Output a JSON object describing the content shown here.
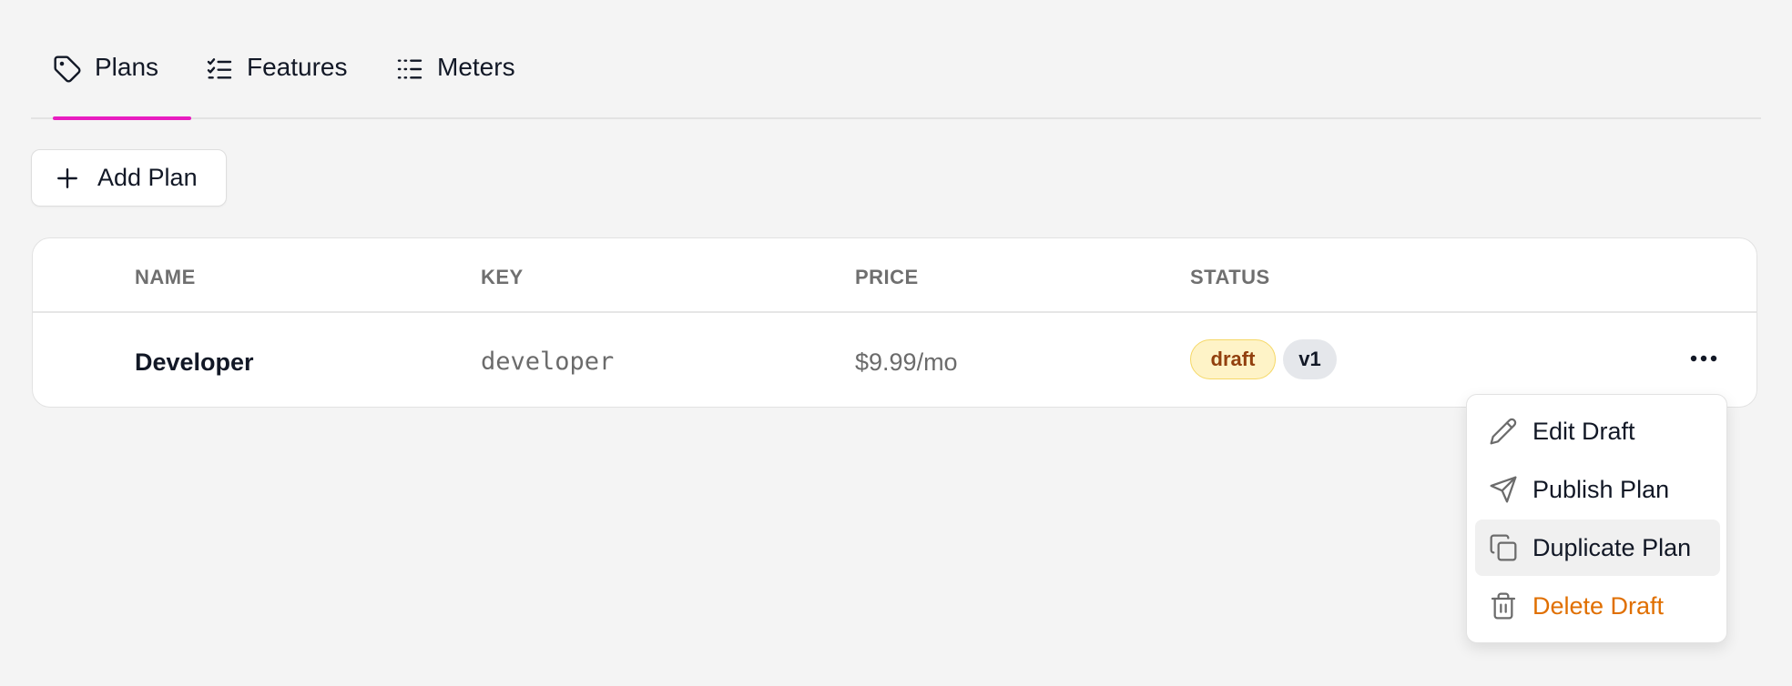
{
  "tabs": [
    {
      "label": "Plans",
      "icon": "tag-icon",
      "active": true
    },
    {
      "label": "Features",
      "icon": "checklist-icon",
      "active": false
    },
    {
      "label": "Meters",
      "icon": "list-icon",
      "active": false
    }
  ],
  "toolbar": {
    "add_label": "Add Plan"
  },
  "table": {
    "columns": [
      "NAME",
      "KEY",
      "PRICE",
      "STATUS"
    ],
    "rows": [
      {
        "name": "Developer",
        "key": "developer",
        "price": "$9.99/mo",
        "status": "draft",
        "version": "v1"
      }
    ]
  },
  "menu": {
    "items": [
      {
        "label": "Edit Draft",
        "icon": "pencil-icon"
      },
      {
        "label": "Publish Plan",
        "icon": "send-icon"
      },
      {
        "label": "Duplicate Plan",
        "icon": "copy-icon",
        "highlighted": true
      },
      {
        "label": "Delete Draft",
        "icon": "trash-icon",
        "danger": true
      }
    ]
  },
  "colors": {
    "accent": "#e81cc0",
    "danger": "#e06f00",
    "draft_bg": "#fef3c7",
    "draft_text": "#92400e"
  }
}
